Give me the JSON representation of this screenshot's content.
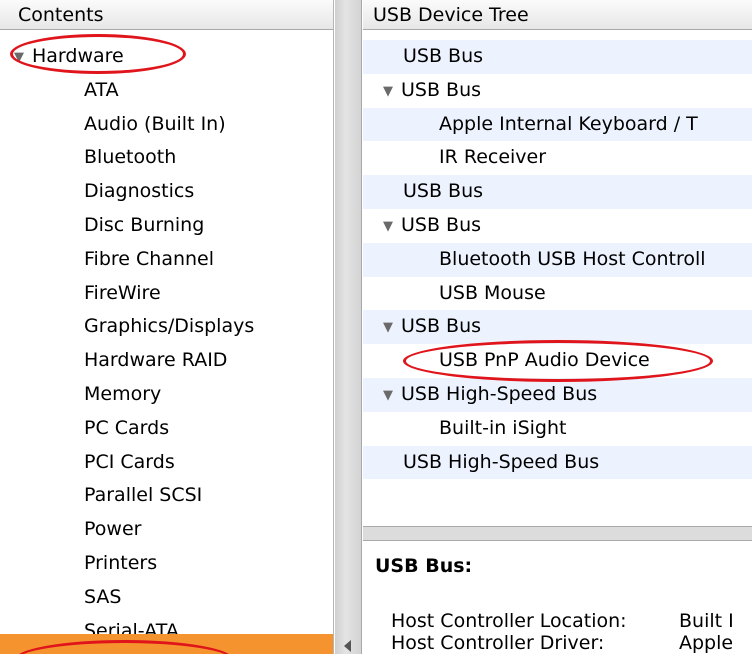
{
  "contents": {
    "header": "Contents",
    "items": [
      {
        "label": "Hardware",
        "level": 0,
        "expanded": true
      },
      {
        "label": "ATA",
        "level": 1
      },
      {
        "label": "Audio (Built In)",
        "level": 1
      },
      {
        "label": "Bluetooth",
        "level": 1
      },
      {
        "label": "Diagnostics",
        "level": 1
      },
      {
        "label": "Disc Burning",
        "level": 1
      },
      {
        "label": "Fibre Channel",
        "level": 1
      },
      {
        "label": "FireWire",
        "level": 1
      },
      {
        "label": "Graphics/Displays",
        "level": 1
      },
      {
        "label": "Hardware RAID",
        "level": 1
      },
      {
        "label": "Memory",
        "level": 1
      },
      {
        "label": "PC Cards",
        "level": 1
      },
      {
        "label": "PCI Cards",
        "level": 1
      },
      {
        "label": "Parallel SCSI",
        "level": 1
      },
      {
        "label": "Power",
        "level": 1
      },
      {
        "label": "Printers",
        "level": 1
      },
      {
        "label": "SAS",
        "level": 1
      },
      {
        "label": "Serial-ATA",
        "level": 1
      }
    ]
  },
  "device_tree": {
    "header": "USB Device Tree",
    "items": [
      {
        "label": "USB Bus",
        "level": 0,
        "expanded": false,
        "selected": true
      },
      {
        "label": "USB Bus",
        "level": 0,
        "expanded": true
      },
      {
        "label": "Apple Internal Keyboard / T",
        "level": 1
      },
      {
        "label": "IR Receiver",
        "level": 1
      },
      {
        "label": "USB Bus",
        "level": 0,
        "expanded": false
      },
      {
        "label": "USB Bus",
        "level": 0,
        "expanded": true
      },
      {
        "label": "Bluetooth USB Host Controll",
        "level": 1
      },
      {
        "label": "USB Mouse",
        "level": 1
      },
      {
        "label": "USB Bus",
        "level": 0,
        "expanded": true
      },
      {
        "label": "USB PnP Audio Device",
        "level": 1
      },
      {
        "label": "USB High-Speed Bus",
        "level": 0,
        "expanded": true
      },
      {
        "label": "Built-in iSight",
        "level": 1
      },
      {
        "label": "USB High-Speed Bus",
        "level": 0,
        "expanded": false
      }
    ]
  },
  "details": {
    "title": "USB Bus:",
    "fields": [
      {
        "key": "Host Controller Location:",
        "value": "Built I"
      },
      {
        "key": "Host Controller Driver:",
        "value": "Apple"
      }
    ]
  },
  "icons": {
    "disclosure": "disclosure-triangle-icon",
    "splitter": "splitter-handle-icon"
  },
  "colors": {
    "selection": "#f5932e",
    "annotation": "#e0141b",
    "alt_row": "#edf3fe"
  }
}
